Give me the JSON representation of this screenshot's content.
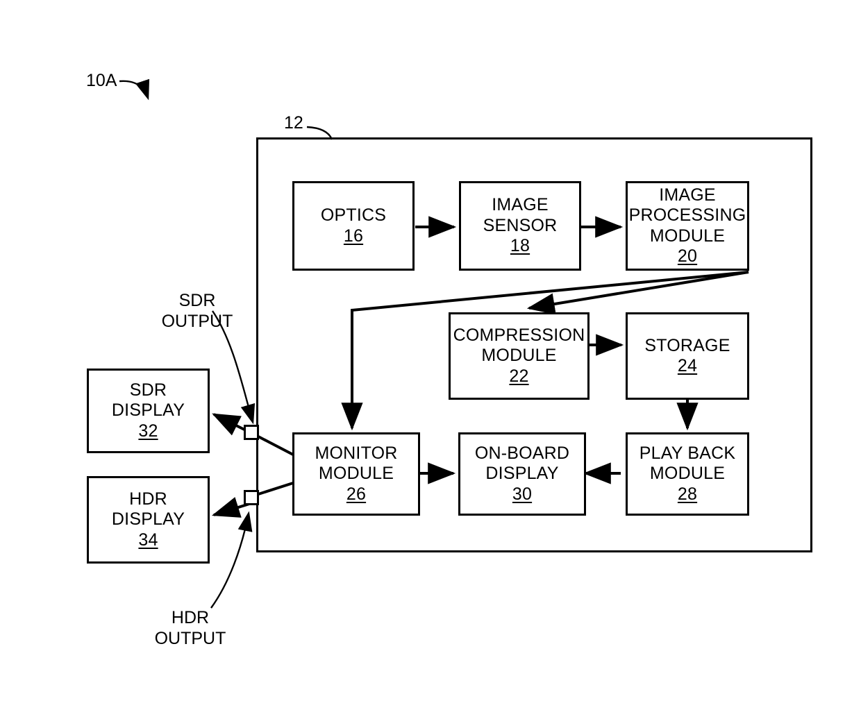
{
  "figure": {
    "reference_numeral": "10A",
    "system_numeral": "12"
  },
  "blocks": [
    {
      "id": "optics",
      "lines": [
        "OPTICS"
      ],
      "num": "16"
    },
    {
      "id": "image-sensor",
      "lines": [
        "IMAGE",
        "SENSOR"
      ],
      "num": "18"
    },
    {
      "id": "image-processing",
      "lines": [
        "IMAGE",
        "PROCESSING",
        "MODULE"
      ],
      "num": "20"
    },
    {
      "id": "compression",
      "lines": [
        "COMPRESSION",
        "MODULE"
      ],
      "num": "22"
    },
    {
      "id": "storage",
      "lines": [
        "STORAGE"
      ],
      "num": "24"
    },
    {
      "id": "monitor",
      "lines": [
        "MONITOR",
        "MODULE"
      ],
      "num": "26"
    },
    {
      "id": "on-board-display",
      "lines": [
        "ON-BOARD",
        "DISPLAY"
      ],
      "num": "30"
    },
    {
      "id": "play-back",
      "lines": [
        "PLAY BACK",
        "MODULE"
      ],
      "num": "28"
    },
    {
      "id": "sdr-display",
      "lines": [
        "SDR",
        "DISPLAY"
      ],
      "num": "32"
    },
    {
      "id": "hdr-display",
      "lines": [
        "HDR",
        "DISPLAY"
      ],
      "num": "34"
    }
  ],
  "annotations": {
    "sdr_output": {
      "line1": "SDR",
      "line2": "OUTPUT"
    },
    "hdr_output": {
      "line1": "HDR",
      "line2": "OUTPUT"
    }
  },
  "style": {
    "stroke": "#000000",
    "background": "#ffffff"
  }
}
